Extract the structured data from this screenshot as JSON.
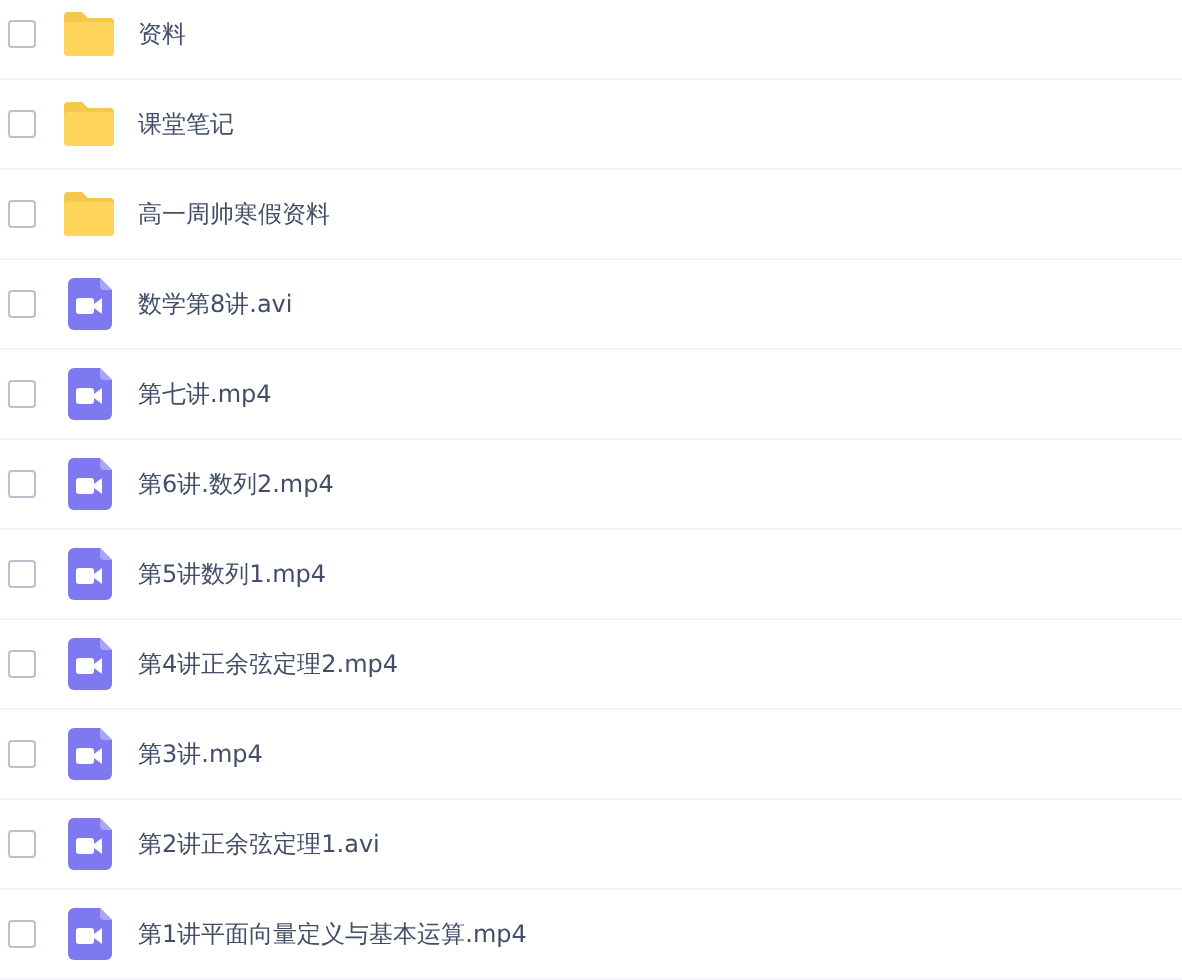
{
  "files": [
    {
      "kind": "folder",
      "name": "资料",
      "checked": false
    },
    {
      "kind": "folder",
      "name": "课堂笔记",
      "checked": false
    },
    {
      "kind": "folder",
      "name": "高一周帅寒假资料",
      "checked": false
    },
    {
      "kind": "video",
      "name": "数学第8讲.avi",
      "checked": false
    },
    {
      "kind": "video",
      "name": "第七讲.mp4",
      "checked": false
    },
    {
      "kind": "video",
      "name": "第6讲.数列2.mp4",
      "checked": false
    },
    {
      "kind": "video",
      "name": "第5讲数列1.mp4",
      "checked": false
    },
    {
      "kind": "video",
      "name": "第4讲正余弦定理2.mp4",
      "checked": false
    },
    {
      "kind": "video",
      "name": "第3讲.mp4",
      "checked": false
    },
    {
      "kind": "video",
      "name": "第2讲正余弦定理1.avi",
      "checked": false
    },
    {
      "kind": "video",
      "name": "第1讲平面向量定义与基本运算.mp4",
      "checked": false
    }
  ]
}
